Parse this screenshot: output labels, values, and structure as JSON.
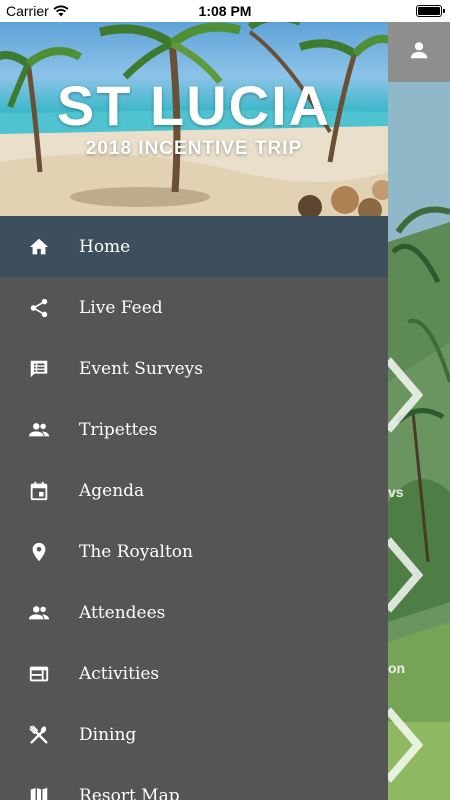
{
  "status_bar": {
    "carrier": "Carrier",
    "time": "1:08 PM"
  },
  "banner": {
    "title": "ST LUCIA",
    "subtitle": "2018 INCENTIVE TRIP"
  },
  "background": {
    "fragment_1": "vs",
    "fragment_2": "on"
  },
  "menu": {
    "items": [
      {
        "label": "Home",
        "icon": "home-icon",
        "active": true
      },
      {
        "label": "Live Feed",
        "icon": "share-icon",
        "active": false
      },
      {
        "label": "Event Surveys",
        "icon": "comment-list-icon",
        "active": false
      },
      {
        "label": "Tripettes",
        "icon": "people-icon",
        "active": false
      },
      {
        "label": "Agenda",
        "icon": "calendar-icon",
        "active": false
      },
      {
        "label": "The Royalton",
        "icon": "location-pin-icon",
        "active": false
      },
      {
        "label": "Attendees",
        "icon": "people-icon",
        "active": false
      },
      {
        "label": "Activities",
        "icon": "web-icon",
        "active": false
      },
      {
        "label": "Dining",
        "icon": "utensils-icon",
        "active": false
      },
      {
        "label": "Resort Map",
        "icon": "map-icon",
        "active": false
      }
    ]
  },
  "colors": {
    "drawer_bg": "#545554",
    "active_item_bg": "#3d4e5c",
    "menu_text": "#ffffff",
    "icon_color": "#ffffff"
  }
}
